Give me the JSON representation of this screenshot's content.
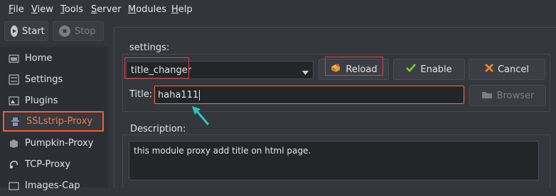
{
  "menu": [
    {
      "underline": "F",
      "rest": "ile"
    },
    {
      "underline": "V",
      "rest": "iew"
    },
    {
      "underline": "T",
      "rest": "ools"
    },
    {
      "underline": "S",
      "rest": "erver"
    },
    {
      "underline": "M",
      "rest": "odules"
    },
    {
      "underline": "H",
      "rest": "elp"
    }
  ],
  "toolbar": {
    "start_label": "Start",
    "stop_label": "Stop"
  },
  "sidebar": {
    "items": [
      {
        "label": "Home"
      },
      {
        "label": "Settings"
      },
      {
        "label": "Plugins"
      },
      {
        "label": "SSLstrip-Proxy"
      },
      {
        "label": "Pumpkin-Proxy"
      },
      {
        "label": "TCP-Proxy"
      },
      {
        "label": "Images-Cap"
      }
    ]
  },
  "settings": {
    "group_title": "settings:",
    "plugin_selected": "title_changer",
    "reload_label": "Reload",
    "enable_label": "Enable",
    "cancel_label": "Cancel",
    "title_label": "Title:",
    "title_value": "haha111",
    "browser_label": "Browser"
  },
  "description": {
    "title": "Description:",
    "text": "this module proxy add title on html page."
  },
  "colors": {
    "accent": "#ff6e2e",
    "highlight_box": "#e0403a",
    "arrow": "#2ec4c4",
    "check": "#7cd13a",
    "cancel_x": "#ff8a2a"
  }
}
